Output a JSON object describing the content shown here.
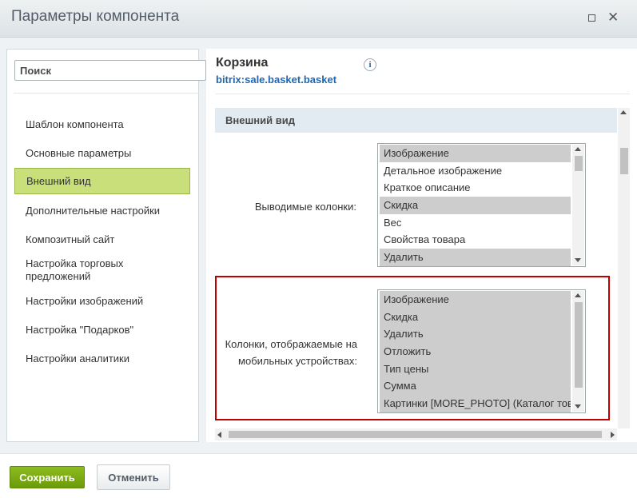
{
  "window": {
    "title": "Параметры компонента"
  },
  "sidebar": {
    "search_placeholder": "Поиск",
    "items": [
      {
        "label": "Шаблон компонента"
      },
      {
        "label": "Основные параметры"
      },
      {
        "label": "Внешний вид",
        "active": true
      },
      {
        "label": "Дополнительные настройки"
      },
      {
        "label": "Композитный сайт"
      },
      {
        "label": "Настройка торговых предложений"
      },
      {
        "label": "Настройки изображений"
      },
      {
        "label": "Настройка \"Подарков\""
      },
      {
        "label": "Настройки аналитики"
      }
    ]
  },
  "component": {
    "name": "Корзина",
    "code": "bitrix:sale.basket.basket"
  },
  "section": {
    "title": "Внешний вид"
  },
  "fields": {
    "columns": {
      "label": "Выводимые колонки:",
      "options": [
        {
          "text": "Изображение",
          "selected": true
        },
        {
          "text": "Детальное изображение",
          "selected": false
        },
        {
          "text": "Краткое описание",
          "selected": false
        },
        {
          "text": "Скидка",
          "selected": true
        },
        {
          "text": "Вес",
          "selected": false
        },
        {
          "text": "Свойства товара",
          "selected": false
        },
        {
          "text": "Удалить",
          "selected": true
        }
      ]
    },
    "mobile_columns": {
      "label_line1": "Колонки, отображаемые на",
      "label_line2": "мобильных устройствах:",
      "options": [
        {
          "text": "Изображение",
          "selected": true
        },
        {
          "text": "Скидка",
          "selected": true
        },
        {
          "text": "Удалить",
          "selected": true
        },
        {
          "text": "Отложить",
          "selected": true
        },
        {
          "text": "Тип цены",
          "selected": true
        },
        {
          "text": "Сумма",
          "selected": true
        },
        {
          "text": "Картинки [MORE_PHOTO] (Каталог тов",
          "selected": true
        }
      ]
    }
  },
  "footer": {
    "save_label": "Сохранить",
    "cancel_label": "Отменить"
  },
  "colors": {
    "active_nav": "#c8df7a",
    "save_button": "#7aa716",
    "link": "#2067b0",
    "highlight_border": "#c00000",
    "section_header_bg": "#e2eaf2"
  },
  "icons": [
    "maximize-icon",
    "close-icon",
    "info-icon",
    "scroll-arrow-icon"
  ]
}
